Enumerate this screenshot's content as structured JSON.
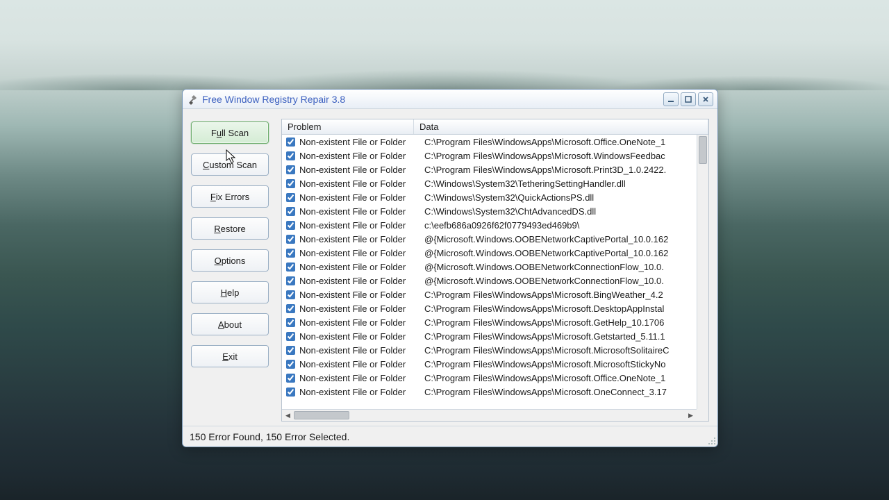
{
  "window": {
    "title": "Free Window Registry Repair 3.8"
  },
  "sidebar": {
    "buttons": [
      {
        "prefix": "F",
        "ul": "u",
        "suffix": "ll Scan"
      },
      {
        "prefix": "",
        "ul": "C",
        "suffix": "ustom Scan"
      },
      {
        "prefix": "",
        "ul": "F",
        "suffix": "ix Errors"
      },
      {
        "prefix": "",
        "ul": "R",
        "suffix": "estore"
      },
      {
        "prefix": "",
        "ul": "O",
        "suffix": "ptions"
      },
      {
        "prefix": "",
        "ul": "H",
        "suffix": "elp"
      },
      {
        "prefix": "",
        "ul": "A",
        "suffix": "bout"
      },
      {
        "prefix": "",
        "ul": "E",
        "suffix": "xit"
      }
    ]
  },
  "list": {
    "columns": {
      "problem": "Problem",
      "data": "Data"
    },
    "rows": [
      {
        "problem": "Non-existent File or Folder",
        "data": "C:\\Program Files\\WindowsApps\\Microsoft.Office.OneNote_1"
      },
      {
        "problem": "Non-existent File or Folder",
        "data": "C:\\Program Files\\WindowsApps\\Microsoft.WindowsFeedbac"
      },
      {
        "problem": "Non-existent File or Folder",
        "data": "C:\\Program Files\\WindowsApps\\Microsoft.Print3D_1.0.2422."
      },
      {
        "problem": "Non-existent File or Folder",
        "data": "C:\\Windows\\System32\\TetheringSettingHandler.dll"
      },
      {
        "problem": "Non-existent File or Folder",
        "data": "C:\\Windows\\System32\\QuickActionsPS.dll"
      },
      {
        "problem": "Non-existent File or Folder",
        "data": "C:\\Windows\\System32\\ChtAdvancedDS.dll"
      },
      {
        "problem": "Non-existent File or Folder",
        "data": "c:\\eefb686a0926f62f0779493ed469b9\\"
      },
      {
        "problem": "Non-existent File or Folder",
        "data": "@{Microsoft.Windows.OOBENetworkCaptivePortal_10.0.162"
      },
      {
        "problem": "Non-existent File or Folder",
        "data": "@{Microsoft.Windows.OOBENetworkCaptivePortal_10.0.162"
      },
      {
        "problem": "Non-existent File or Folder",
        "data": "@{Microsoft.Windows.OOBENetworkConnectionFlow_10.0."
      },
      {
        "problem": "Non-existent File or Folder",
        "data": "@{Microsoft.Windows.OOBENetworkConnectionFlow_10.0."
      },
      {
        "problem": "Non-existent File or Folder",
        "data": "C:\\Program Files\\WindowsApps\\Microsoft.BingWeather_4.2"
      },
      {
        "problem": "Non-existent File or Folder",
        "data": "C:\\Program Files\\WindowsApps\\Microsoft.DesktopAppInstal"
      },
      {
        "problem": "Non-existent File or Folder",
        "data": "C:\\Program Files\\WindowsApps\\Microsoft.GetHelp_10.1706"
      },
      {
        "problem": "Non-existent File or Folder",
        "data": "C:\\Program Files\\WindowsApps\\Microsoft.Getstarted_5.11.1"
      },
      {
        "problem": "Non-existent File or Folder",
        "data": "C:\\Program Files\\WindowsApps\\Microsoft.MicrosoftSolitaireC"
      },
      {
        "problem": "Non-existent File or Folder",
        "data": "C:\\Program Files\\WindowsApps\\Microsoft.MicrosoftStickyNo"
      },
      {
        "problem": "Non-existent File or Folder",
        "data": "C:\\Program Files\\WindowsApps\\Microsoft.Office.OneNote_1"
      },
      {
        "problem": "Non-existent File or Folder",
        "data": "C:\\Program Files\\WindowsApps\\Microsoft.OneConnect_3.17"
      }
    ]
  },
  "status": "150 Error Found,  150 Error Selected."
}
